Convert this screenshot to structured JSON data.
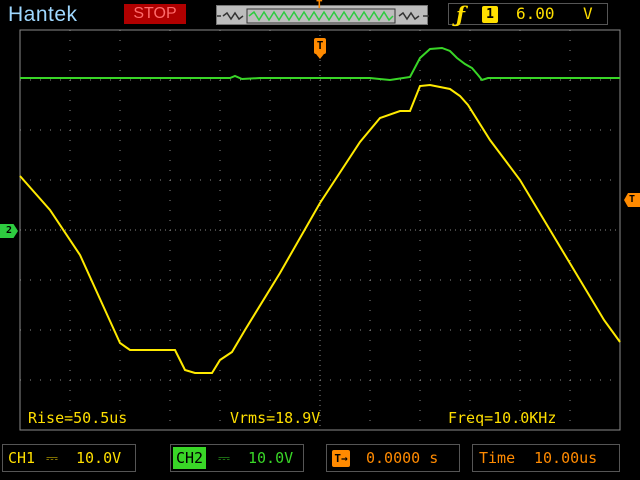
{
  "header": {
    "brand": "Hantek",
    "run_state": "STOP",
    "trigger": {
      "edge_icon": "rising-edge-icon",
      "channel": "1",
      "level": "6.00",
      "unit": "V"
    }
  },
  "markers": {
    "trigger_position": "T",
    "ch2_ground": "2"
  },
  "measurements": {
    "rise": "Rise=50.5us",
    "vrms": "Vrms=18.9V",
    "freq": "Freq=10.0KHz"
  },
  "footer": {
    "ch1_label": "CH1",
    "ch1_coupling_icon": "dc-coupling-icon",
    "ch1_scale": "10.0V",
    "ch2_label": "CH2",
    "ch2_coupling_icon": "dc-coupling-icon",
    "ch2_scale": "10.0V",
    "trigger_offset": "0.0000 s",
    "time_label": "Time",
    "time_scale": "10.00us"
  },
  "colors": {
    "ch1": "#ffea00",
    "ch2": "#39d627",
    "accent": "#ff8a00",
    "brand": "#9fd8ff",
    "stop": "#b00000"
  }
}
